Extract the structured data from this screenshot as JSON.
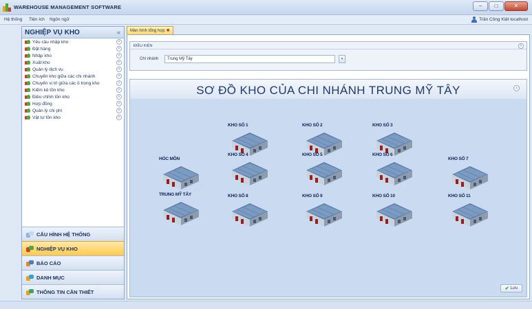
{
  "window": {
    "title": "WAREHOUSE MANAGEMENT SOFTWARE",
    "minimize_icon": "minimize-icon",
    "maximize_icon": "maximize-icon",
    "close_icon": "close-icon"
  },
  "menubar": {
    "items": [
      "Hệ thống",
      "Tiện ích",
      "Ngôn ngữ"
    ],
    "user": "Trần Công Kiệt localhost"
  },
  "sidebar": {
    "header": "NGHIỆP VỤ KHO",
    "collapse_label": "«",
    "items": [
      "Yêu cầu nhập kho",
      "Đặt hàng",
      "Nhập kho",
      "Xuất kho",
      "Quản lý dịch vụ",
      "Chuyển kho giữa các chi nhánh",
      "Chuyển vị trí giữa các ô trong kho",
      "Kiểm kê tồn kho",
      "Điều chỉnh tồn kho",
      "Hợp đồng",
      "Quản lý chi phí",
      "Vật tư tồn kho"
    ],
    "groups": [
      {
        "label": "CẤU HÌNH HỆ THỐNG",
        "icon": "system-config-icon"
      },
      {
        "label": "NGHIỆP VỤ KHO",
        "icon": "warehouse-ops-icon",
        "active": true
      },
      {
        "label": "BÁO CÁO",
        "icon": "report-icon"
      },
      {
        "label": "DANH MỤC",
        "icon": "catalog-icon"
      },
      {
        "label": "THÔNG TIN CẦN THIẾT",
        "icon": "info-icon"
      }
    ]
  },
  "tab": {
    "label": "Màn hình tổng hợp",
    "close": "✖"
  },
  "condition": {
    "header": "ĐIỀU KIỆN",
    "branch_label": "Chi nhánh",
    "branch_value": "Trung Mỹ Tây"
  },
  "map": {
    "title": "SƠ ĐỒ KHO CỦA CHI NHÁNH TRUNG MỸ TÂY",
    "warehouses": [
      "KHO SỐ 1",
      "KHO SỐ 2",
      "KHO SỐ 3",
      "HÓC MÔN",
      "KHO SỐ 4",
      "KHO SỐ 5",
      "KHO SỐ 6",
      "KHO SỐ 7",
      "TRUNG MỸ TÂY",
      "KHO SỐ 8",
      "KHO SỐ 9",
      "KHO SỐ 10",
      "KHO SỐ 11"
    ]
  },
  "actions": {
    "save_label": "Lưu"
  },
  "colors": {
    "accent": "#203a6b",
    "active_group": "#ffc94e",
    "map_background": "#c9daf1"
  }
}
